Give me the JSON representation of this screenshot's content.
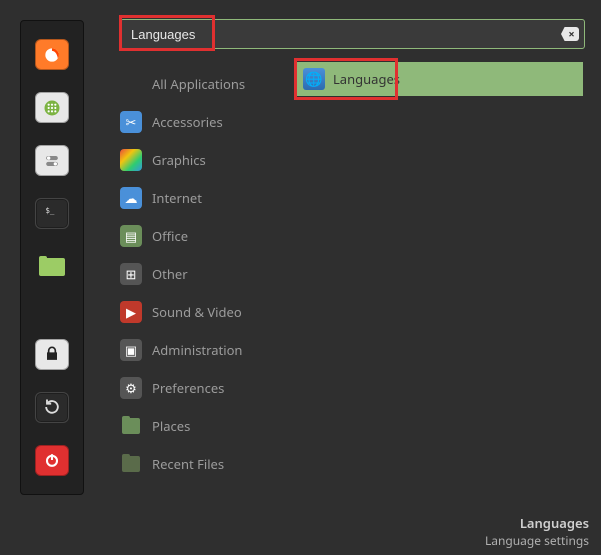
{
  "search": {
    "value": "Languages",
    "clear_glyph": "×"
  },
  "categories": [
    {
      "id": "all",
      "label": "All Applications"
    },
    {
      "id": "accessories",
      "label": "Accessories"
    },
    {
      "id": "graphics",
      "label": "Graphics"
    },
    {
      "id": "internet",
      "label": "Internet"
    },
    {
      "id": "office",
      "label": "Office"
    },
    {
      "id": "other",
      "label": "Other"
    },
    {
      "id": "sound-video",
      "label": "Sound & Video"
    },
    {
      "id": "administration",
      "label": "Administration"
    },
    {
      "id": "preferences",
      "label": "Preferences"
    },
    {
      "id": "places",
      "label": "Places"
    },
    {
      "id": "recent",
      "label": "Recent Files"
    }
  ],
  "results": [
    {
      "id": "languages",
      "label": "Languages",
      "selected": true
    }
  ],
  "status": {
    "title": "Languages",
    "subtitle": "Language settings"
  },
  "launcher": [
    {
      "id": "firefox"
    },
    {
      "id": "apps"
    },
    {
      "id": "settings"
    },
    {
      "id": "terminal"
    },
    {
      "id": "files"
    },
    {
      "id": "lock"
    },
    {
      "id": "restart"
    },
    {
      "id": "power"
    }
  ]
}
